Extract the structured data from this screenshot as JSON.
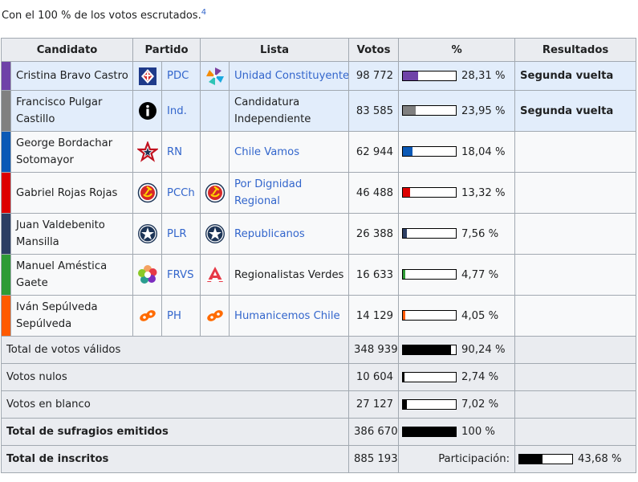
{
  "caption": {
    "text": "Con el 100 % de los votos escrutados.",
    "ref": "4"
  },
  "headers": [
    "Candidato",
    "Partido",
    "Lista",
    "Votos",
    "%",
    "Resultados"
  ],
  "candidates": [
    {
      "name": "Cristina Bravo Castro",
      "party": "PDC",
      "list": "Unidad Constituyente",
      "votes": "98 772",
      "pct": "28,31 %",
      "pct_value": 28.31,
      "result": "Segunda vuelta",
      "color": "#6f42a8",
      "winner": true
    },
    {
      "name": "Francisco Pulgar Castillo",
      "party": "Ind.",
      "list": "Candidatura Independiente",
      "votes": "83 585",
      "pct": "23,95 %",
      "pct_value": 23.95,
      "result": "Segunda vuelta",
      "color": "#808080",
      "winner": true
    },
    {
      "name": "George Bordachar Sotomayor",
      "party": "RN",
      "list": "Chile Vamos",
      "votes": "62 944",
      "pct": "18,04 %",
      "pct_value": 18.04,
      "result": "",
      "color": "#0b59b6",
      "winner": false
    },
    {
      "name": "Gabriel Rojas Rojas",
      "party": "PCCh",
      "list": "Por Dignidad Regional",
      "votes": "46 488",
      "pct": "13,32 %",
      "pct_value": 13.32,
      "result": "",
      "color": "#dd0000",
      "winner": false
    },
    {
      "name": "Juan Valdebenito Mansilla",
      "party": "PLR",
      "list": "Republicanos",
      "votes": "26 388",
      "pct": "7,56 %",
      "pct_value": 7.56,
      "result": "",
      "color": "#2c3e63",
      "winner": false
    },
    {
      "name": "Manuel Améstica Gaete",
      "party": "FRVS",
      "list": "Regionalistas Verdes",
      "votes": "16 633",
      "pct": "4,77 %",
      "pct_value": 4.77,
      "result": "",
      "color": "#2e9b35",
      "winner": false
    },
    {
      "name": "Iván Sepúlveda Sepúlveda",
      "party": "PH",
      "list": "Humanicemos Chile",
      "votes": "14 129",
      "pct": "4,05 %",
      "pct_value": 4.05,
      "result": "",
      "color": "#ff5a00",
      "winner": false
    }
  ],
  "totals": {
    "valid": {
      "label": "Total de votos válidos",
      "votes": "348 939",
      "pct": "90,24 %",
      "pct_value": 90.24
    },
    "null": {
      "label": "Votos nulos",
      "votes": "10 604",
      "pct": "2,74 %",
      "pct_value": 2.74
    },
    "blank": {
      "label": "Votos en blanco",
      "votes": "27 127",
      "pct": "7,02 %",
      "pct_value": 7.02
    },
    "emitted": {
      "label": "Total de sufragios emitidos",
      "votes": "386 670",
      "pct": "100 %",
      "pct_value": 100
    },
    "registered": {
      "label": "Total de inscritos",
      "votes": "885 193",
      "participation_label": "Participación:",
      "pct": "43,68 %",
      "pct_value": 43.68
    }
  }
}
